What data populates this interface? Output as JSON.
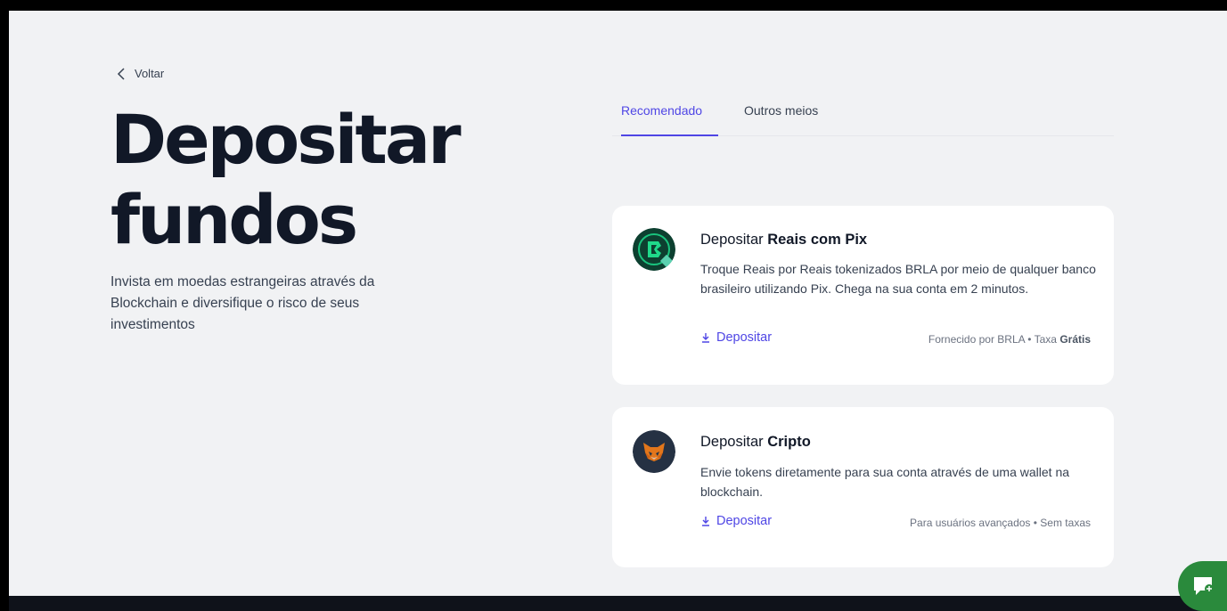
{
  "nav": {
    "back_label": "Voltar"
  },
  "hero": {
    "title_line1": "Depositar",
    "title_line2": "fundos",
    "subtitle": "Invista em moedas estrangeiras através da Blockchain e diversifique o risco de seus investimentos"
  },
  "tabs": [
    {
      "label": "Recomendado",
      "active": true
    },
    {
      "label": "Outros meios",
      "active": false
    }
  ],
  "cards": [
    {
      "title_prefix": "Depositar ",
      "title_bold": "Reais com Pix",
      "description": "Troque Reais por Reais tokenizados BRLA por meio de qualquer banco brasileiro utilizando Pix. Chega na sua conta em 2 minutos.",
      "action_label": "Depositar",
      "meta_prefix": "Fornecido por BRLA • Taxa ",
      "meta_bold": "Grátis",
      "icon": "brla-pix-icon"
    },
    {
      "title_prefix": "Depositar ",
      "title_bold": "Cripto",
      "description": "Envie tokens diretamente para sua conta através de uma wallet na blockchain.",
      "action_label": "Depositar",
      "meta_prefix": "Para usuários avançados • Sem taxas",
      "meta_bold": "",
      "icon": "metamask-fox-icon"
    }
  ],
  "colors": {
    "accent": "#4f46e5",
    "background": "#f1f2f4",
    "chat": "#2a8a3c"
  }
}
